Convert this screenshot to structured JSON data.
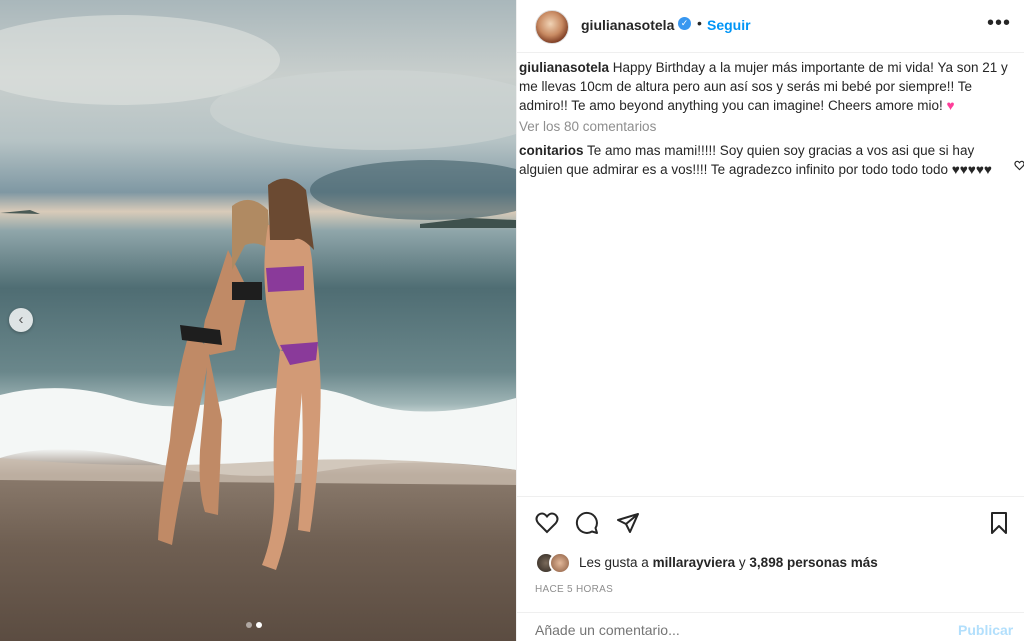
{
  "post": {
    "username": "giulianasotela",
    "follow_label": "Seguir",
    "separator": "•",
    "more_label": "•••",
    "caption_text": "Happy Birthday a la mujer más importante de mi vida! Ya son 21 y me llevas 10cm de altura pero aun así sos y serás mi bebé por siempre!! Te admiro!! Te amo beyond anything you can imagine! Cheers amore mio! ",
    "caption_emoji": "♥",
    "view_all_comments": "Ver los 80 comentarios",
    "comment": {
      "username": "conitarios",
      "text": "Te amo mas mami!!!!! Soy quien soy gracias a vos asi que si hay alguien que admirar es a vos!!!! Te agradezco infinito por todo todo todo ♥♥♥♥♥",
      "like_icon": "heart-outline-icon"
    },
    "likes_prefix": "Les gusta a",
    "likes_user": "millarayviera",
    "likes_and": "y",
    "likes_count": "3,898 personas más",
    "time": "HACE 5 HORAS",
    "add_comment_placeholder": "Añade un comentario...",
    "publish_label": "Publicar"
  },
  "carousel": {
    "prev_icon": "chevron-left-icon",
    "prev_glyph": "‹",
    "total": 2,
    "active": 2
  },
  "icons": {
    "like": "heart-outline-icon",
    "comment": "comment-bubble-icon",
    "share": "paper-plane-icon",
    "save": "bookmark-icon",
    "verified": "verified-badge-icon",
    "verified_glyph": "✓"
  },
  "colors": {
    "link": "#0095f6",
    "verified": "#3897f0",
    "muted": "#8e8e8e",
    "text": "#262626"
  }
}
